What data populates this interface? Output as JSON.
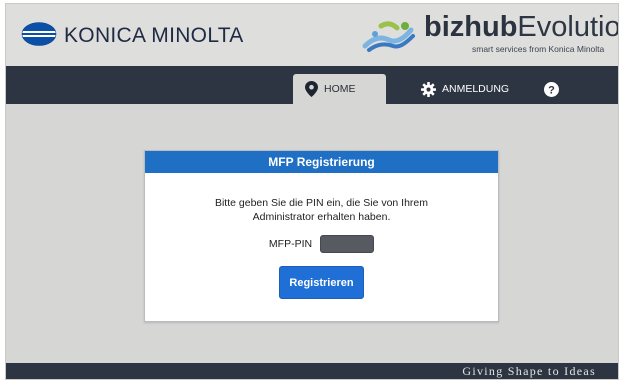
{
  "header": {
    "brand_name": "KONICA MINOLTA",
    "product_bold": "bizhub",
    "product_light": "Evolution",
    "product_tagline": "smart services from Konica Minolta"
  },
  "nav": {
    "tabs": [
      {
        "label": "HOME",
        "icon": "map-pin-icon",
        "active": true
      },
      {
        "label": "ANMELDUNG",
        "icon": "gear-icon",
        "active": false
      },
      {
        "label": "",
        "icon": "help-icon",
        "active": false
      }
    ],
    "help_glyph": "?"
  },
  "dialog": {
    "title": "MFP Registrierung",
    "message": "Bitte geben Sie die PIN ein, die Sie von Ihrem Administrator erhalten haben.",
    "pin_label": "MFP-PIN",
    "pin_value": "",
    "button_label": "Registrieren"
  },
  "footer": {
    "slogan": "Giving Shape to Ideas"
  },
  "colors": {
    "accent_blue": "#1f6fc4",
    "navbar": "#2c3541",
    "background": "#d6d6d4"
  }
}
